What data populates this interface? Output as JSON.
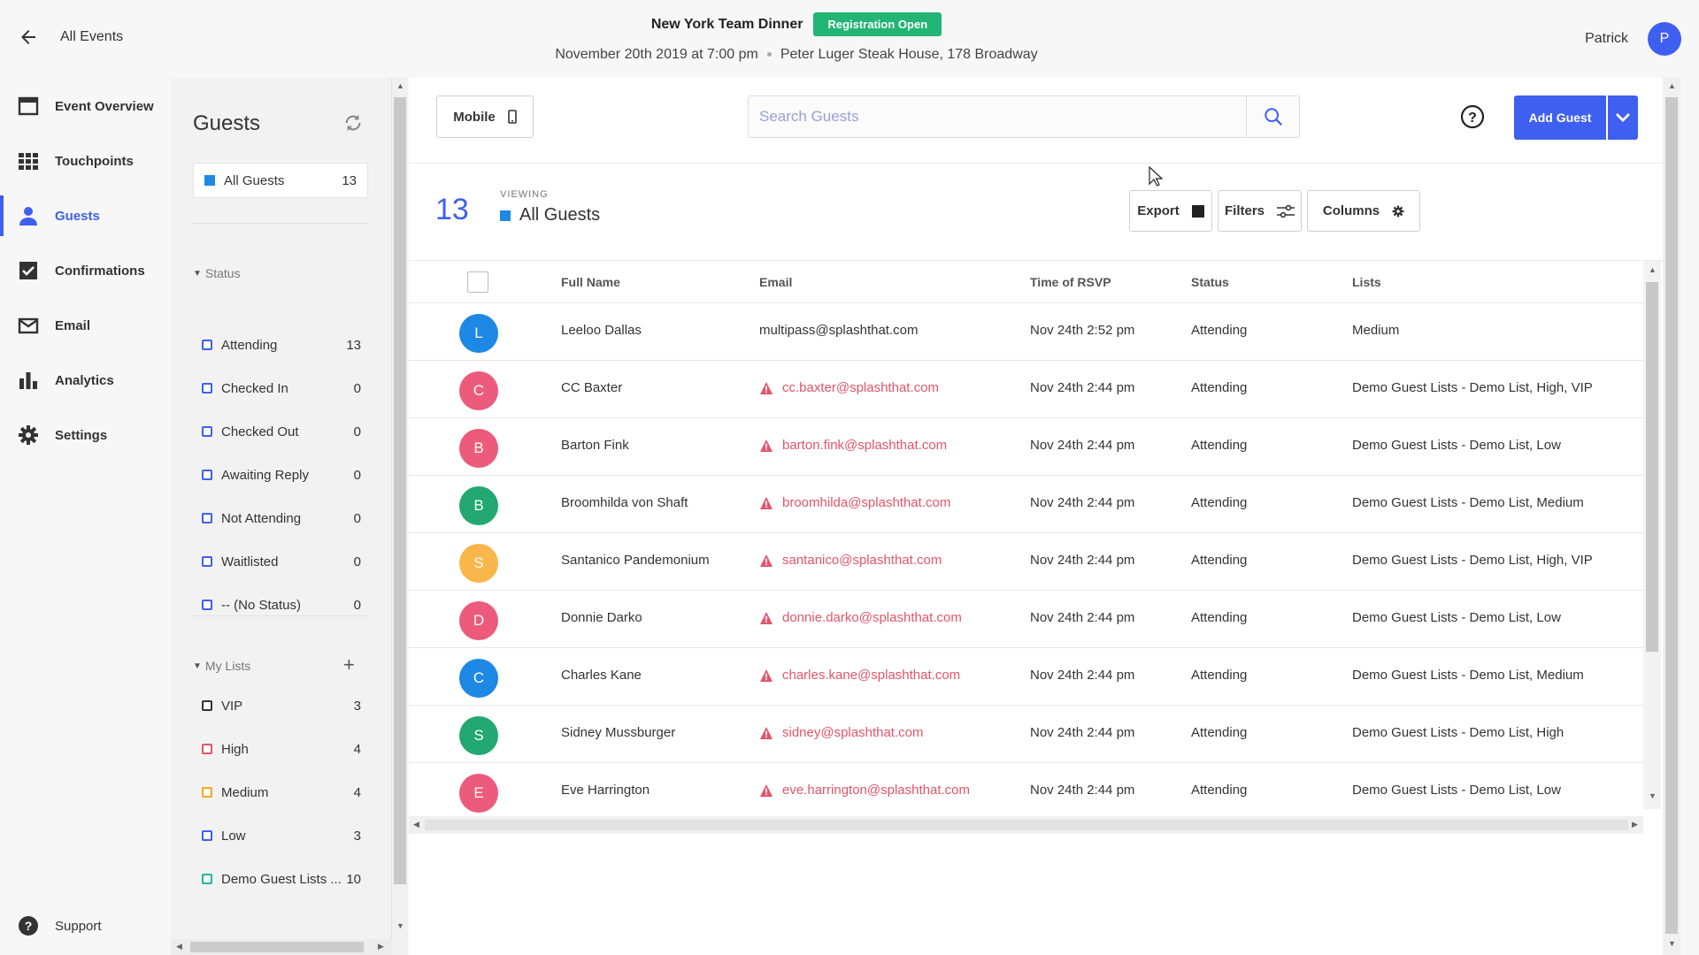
{
  "header": {
    "back_label": "All Events",
    "event_title": "New York Team Dinner",
    "status_badge": "Registration Open",
    "event_datetime": "November 20th 2019 at 7:00 pm",
    "event_location": "Peter Luger Steak House, 178 Broadway",
    "user_name": "Patrick",
    "user_initial": "P"
  },
  "nav": {
    "items": [
      {
        "label": "Event Overview",
        "icon": "calendar-icon"
      },
      {
        "label": "Touchpoints",
        "icon": "grid-icon"
      },
      {
        "label": "Guests",
        "icon": "person-icon",
        "active": true
      },
      {
        "label": "Confirmations",
        "icon": "checkbox-icon"
      },
      {
        "label": "Email",
        "icon": "envelope-icon"
      },
      {
        "label": "Analytics",
        "icon": "bar-chart-icon"
      },
      {
        "label": "Settings",
        "icon": "gear-icon"
      }
    ],
    "support_label": "Support"
  },
  "guests_panel": {
    "title": "Guests",
    "all_guests": {
      "label": "All Guests",
      "count": "13"
    },
    "status_heading": "Status",
    "statuses": [
      {
        "label": "Attending",
        "count": "13"
      },
      {
        "label": "Checked In",
        "count": "0"
      },
      {
        "label": "Checked Out",
        "count": "0"
      },
      {
        "label": "Awaiting Reply",
        "count": "0"
      },
      {
        "label": "Not Attending",
        "count": "0"
      },
      {
        "label": "Waitlisted",
        "count": "0"
      },
      {
        "label": "-- (No Status)",
        "count": "0"
      }
    ],
    "lists_heading": "My Lists",
    "lists": [
      {
        "label": "VIP",
        "count": "3",
        "color": "#333333"
      },
      {
        "label": "High",
        "count": "4",
        "color": "#e2556b"
      },
      {
        "label": "Medium",
        "count": "4",
        "color": "#f5a623"
      },
      {
        "label": "Low",
        "count": "3",
        "color": "#3f5ff0"
      },
      {
        "label": "Demo Guest Lists ...",
        "count": "10",
        "color": "#22b5a0"
      }
    ]
  },
  "toolbar": {
    "mobile_label": "Mobile",
    "search_placeholder": "Search Guests",
    "add_guest_label": "Add Guest"
  },
  "summary": {
    "count": "13",
    "viewing_label": "VIEWING",
    "viewing_value": "All Guests",
    "export_label": "Export",
    "filters_label": "Filters",
    "columns_label": "Columns"
  },
  "table": {
    "columns": [
      "Full Name",
      "Email",
      "Time of RSVP",
      "Status",
      "Lists"
    ],
    "rows": [
      {
        "initial": "L",
        "color": "#1e88e5",
        "name": "Leeloo Dallas",
        "email": "multipass@splashthat.com",
        "warn": false,
        "time": "Nov 24th 2:52 pm",
        "status": "Attending",
        "lists": "Medium"
      },
      {
        "initial": "C",
        "color": "#ec5b7b",
        "name": "CC Baxter",
        "email": "cc.baxter@splashthat.com",
        "warn": true,
        "time": "Nov 24th 2:44 pm",
        "status": "Attending",
        "lists": "Demo Guest Lists - Demo List, High, VIP"
      },
      {
        "initial": "B",
        "color": "#ec5b7b",
        "name": "Barton Fink",
        "email": "barton.fink@splashthat.com",
        "warn": true,
        "time": "Nov 24th 2:44 pm",
        "status": "Attending",
        "lists": "Demo Guest Lists - Demo List, Low"
      },
      {
        "initial": "B",
        "color": "#22a870",
        "name": "Broomhilda von Shaft",
        "email": "broomhilda@splashthat.com",
        "warn": true,
        "time": "Nov 24th 2:44 pm",
        "status": "Attending",
        "lists": "Demo Guest Lists - Demo List, Medium"
      },
      {
        "initial": "S",
        "color": "#f9b64b",
        "name": "Santanico Pandemonium",
        "email": "santanico@splashthat.com",
        "warn": true,
        "time": "Nov 24th 2:44 pm",
        "status": "Attending",
        "lists": "Demo Guest Lists - Demo List, High, VIP"
      },
      {
        "initial": "D",
        "color": "#ec5b7b",
        "name": "Donnie Darko",
        "email": "donnie.darko@splashthat.com",
        "warn": true,
        "time": "Nov 24th 2:44 pm",
        "status": "Attending",
        "lists": "Demo Guest Lists - Demo List, Low"
      },
      {
        "initial": "C",
        "color": "#1e88e5",
        "name": "Charles Kane",
        "email": "charles.kane@splashthat.com",
        "warn": true,
        "time": "Nov 24th 2:44 pm",
        "status": "Attending",
        "lists": "Demo Guest Lists - Demo List, Medium"
      },
      {
        "initial": "S",
        "color": "#22a870",
        "name": "Sidney Mussburger",
        "email": "sidney@splashthat.com",
        "warn": true,
        "time": "Nov 24th 2:44 pm",
        "status": "Attending",
        "lists": "Demo Guest Lists - Demo List, High"
      },
      {
        "initial": "E",
        "color": "#ec5b7b",
        "name": "Eve Harrington",
        "email": "eve.harrington@splashthat.com",
        "warn": true,
        "time": "Nov 24th 2:44 pm",
        "status": "Attending",
        "lists": "Demo Guest Lists - Demo List, Low"
      }
    ]
  },
  "colors": {
    "accent": "#3f5ff0",
    "success": "#22b573",
    "warning_text": "#e2556b"
  }
}
